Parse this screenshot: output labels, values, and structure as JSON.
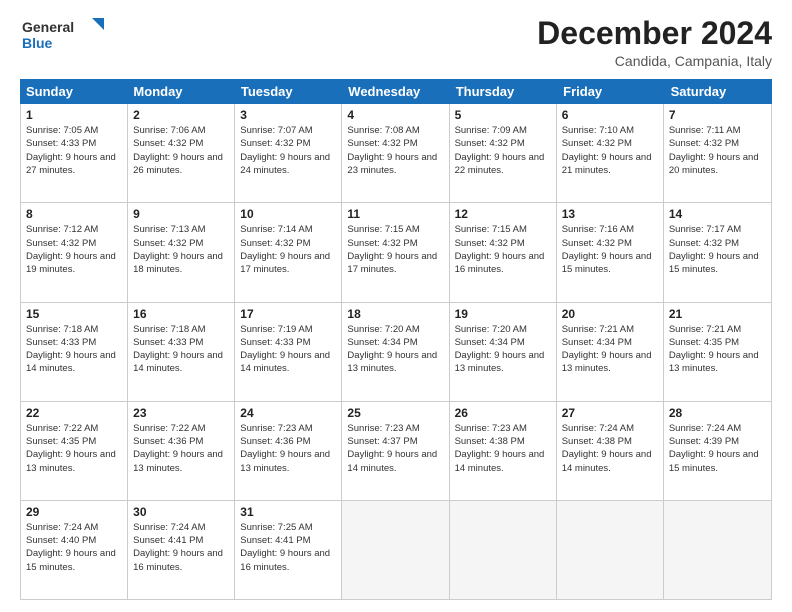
{
  "logo": {
    "line1": "General",
    "line2": "Blue"
  },
  "title": "December 2024",
  "location": "Candida, Campania, Italy",
  "headers": [
    "Sunday",
    "Monday",
    "Tuesday",
    "Wednesday",
    "Thursday",
    "Friday",
    "Saturday"
  ],
  "weeks": [
    [
      {
        "day": "1",
        "sunrise": "Sunrise: 7:05 AM",
        "sunset": "Sunset: 4:33 PM",
        "daylight": "Daylight: 9 hours and 27 minutes."
      },
      {
        "day": "2",
        "sunrise": "Sunrise: 7:06 AM",
        "sunset": "Sunset: 4:32 PM",
        "daylight": "Daylight: 9 hours and 26 minutes."
      },
      {
        "day": "3",
        "sunrise": "Sunrise: 7:07 AM",
        "sunset": "Sunset: 4:32 PM",
        "daylight": "Daylight: 9 hours and 24 minutes."
      },
      {
        "day": "4",
        "sunrise": "Sunrise: 7:08 AM",
        "sunset": "Sunset: 4:32 PM",
        "daylight": "Daylight: 9 hours and 23 minutes."
      },
      {
        "day": "5",
        "sunrise": "Sunrise: 7:09 AM",
        "sunset": "Sunset: 4:32 PM",
        "daylight": "Daylight: 9 hours and 22 minutes."
      },
      {
        "day": "6",
        "sunrise": "Sunrise: 7:10 AM",
        "sunset": "Sunset: 4:32 PM",
        "daylight": "Daylight: 9 hours and 21 minutes."
      },
      {
        "day": "7",
        "sunrise": "Sunrise: 7:11 AM",
        "sunset": "Sunset: 4:32 PM",
        "daylight": "Daylight: 9 hours and 20 minutes."
      }
    ],
    [
      {
        "day": "8",
        "sunrise": "Sunrise: 7:12 AM",
        "sunset": "Sunset: 4:32 PM",
        "daylight": "Daylight: 9 hours and 19 minutes."
      },
      {
        "day": "9",
        "sunrise": "Sunrise: 7:13 AM",
        "sunset": "Sunset: 4:32 PM",
        "daylight": "Daylight: 9 hours and 18 minutes."
      },
      {
        "day": "10",
        "sunrise": "Sunrise: 7:14 AM",
        "sunset": "Sunset: 4:32 PM",
        "daylight": "Daylight: 9 hours and 17 minutes."
      },
      {
        "day": "11",
        "sunrise": "Sunrise: 7:15 AM",
        "sunset": "Sunset: 4:32 PM",
        "daylight": "Daylight: 9 hours and 17 minutes."
      },
      {
        "day": "12",
        "sunrise": "Sunrise: 7:15 AM",
        "sunset": "Sunset: 4:32 PM",
        "daylight": "Daylight: 9 hours and 16 minutes."
      },
      {
        "day": "13",
        "sunrise": "Sunrise: 7:16 AM",
        "sunset": "Sunset: 4:32 PM",
        "daylight": "Daylight: 9 hours and 15 minutes."
      },
      {
        "day": "14",
        "sunrise": "Sunrise: 7:17 AM",
        "sunset": "Sunset: 4:32 PM",
        "daylight": "Daylight: 9 hours and 15 minutes."
      }
    ],
    [
      {
        "day": "15",
        "sunrise": "Sunrise: 7:18 AM",
        "sunset": "Sunset: 4:33 PM",
        "daylight": "Daylight: 9 hours and 14 minutes."
      },
      {
        "day": "16",
        "sunrise": "Sunrise: 7:18 AM",
        "sunset": "Sunset: 4:33 PM",
        "daylight": "Daylight: 9 hours and 14 minutes."
      },
      {
        "day": "17",
        "sunrise": "Sunrise: 7:19 AM",
        "sunset": "Sunset: 4:33 PM",
        "daylight": "Daylight: 9 hours and 14 minutes."
      },
      {
        "day": "18",
        "sunrise": "Sunrise: 7:20 AM",
        "sunset": "Sunset: 4:34 PM",
        "daylight": "Daylight: 9 hours and 13 minutes."
      },
      {
        "day": "19",
        "sunrise": "Sunrise: 7:20 AM",
        "sunset": "Sunset: 4:34 PM",
        "daylight": "Daylight: 9 hours and 13 minutes."
      },
      {
        "day": "20",
        "sunrise": "Sunrise: 7:21 AM",
        "sunset": "Sunset: 4:34 PM",
        "daylight": "Daylight: 9 hours and 13 minutes."
      },
      {
        "day": "21",
        "sunrise": "Sunrise: 7:21 AM",
        "sunset": "Sunset: 4:35 PM",
        "daylight": "Daylight: 9 hours and 13 minutes."
      }
    ],
    [
      {
        "day": "22",
        "sunrise": "Sunrise: 7:22 AM",
        "sunset": "Sunset: 4:35 PM",
        "daylight": "Daylight: 9 hours and 13 minutes."
      },
      {
        "day": "23",
        "sunrise": "Sunrise: 7:22 AM",
        "sunset": "Sunset: 4:36 PM",
        "daylight": "Daylight: 9 hours and 13 minutes."
      },
      {
        "day": "24",
        "sunrise": "Sunrise: 7:23 AM",
        "sunset": "Sunset: 4:36 PM",
        "daylight": "Daylight: 9 hours and 13 minutes."
      },
      {
        "day": "25",
        "sunrise": "Sunrise: 7:23 AM",
        "sunset": "Sunset: 4:37 PM",
        "daylight": "Daylight: 9 hours and 14 minutes."
      },
      {
        "day": "26",
        "sunrise": "Sunrise: 7:23 AM",
        "sunset": "Sunset: 4:38 PM",
        "daylight": "Daylight: 9 hours and 14 minutes."
      },
      {
        "day": "27",
        "sunrise": "Sunrise: 7:24 AM",
        "sunset": "Sunset: 4:38 PM",
        "daylight": "Daylight: 9 hours and 14 minutes."
      },
      {
        "day": "28",
        "sunrise": "Sunrise: 7:24 AM",
        "sunset": "Sunset: 4:39 PM",
        "daylight": "Daylight: 9 hours and 15 minutes."
      }
    ],
    [
      {
        "day": "29",
        "sunrise": "Sunrise: 7:24 AM",
        "sunset": "Sunset: 4:40 PM",
        "daylight": "Daylight: 9 hours and 15 minutes."
      },
      {
        "day": "30",
        "sunrise": "Sunrise: 7:24 AM",
        "sunset": "Sunset: 4:41 PM",
        "daylight": "Daylight: 9 hours and 16 minutes."
      },
      {
        "day": "31",
        "sunrise": "Sunrise: 7:25 AM",
        "sunset": "Sunset: 4:41 PM",
        "daylight": "Daylight: 9 hours and 16 minutes."
      },
      null,
      null,
      null,
      null
    ]
  ]
}
